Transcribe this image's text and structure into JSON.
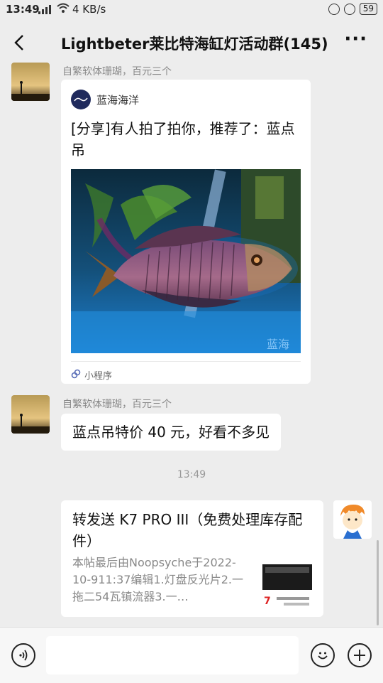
{
  "status_bar": {
    "time": "13:49",
    "net_speed": "4 KB/s",
    "battery": "59"
  },
  "header": {
    "title": "Lightbeter莱比特海缸灯活动群(145)",
    "more_label": "···"
  },
  "messages": [
    {
      "sender": "自繁软体珊瑚，百元三个",
      "card": {
        "source_name": "蓝海海洋",
        "title": "[分享]有人拍了拍你，推荐了：蓝点吊",
        "footer": "小程序",
        "watermark": "蓝海"
      }
    },
    {
      "sender": "自繁软体珊瑚，百元三个",
      "text": "蓝点吊特价 40 元，好看不多见"
    }
  ],
  "timestamp": "13:49",
  "link_message": {
    "title": "转发送 K7 PRO III（免费处理库存配件）",
    "description": "本帖最后由Noopsyche于2022-10-911:37编辑1.灯盘反光片2.一拖二54瓦镇流器3.一…",
    "thumb_caption": "7"
  },
  "input_bar": {
    "voice_icon": "voice-icon",
    "emoji_icon": "emoji-icon",
    "add_icon": "plus-icon"
  }
}
